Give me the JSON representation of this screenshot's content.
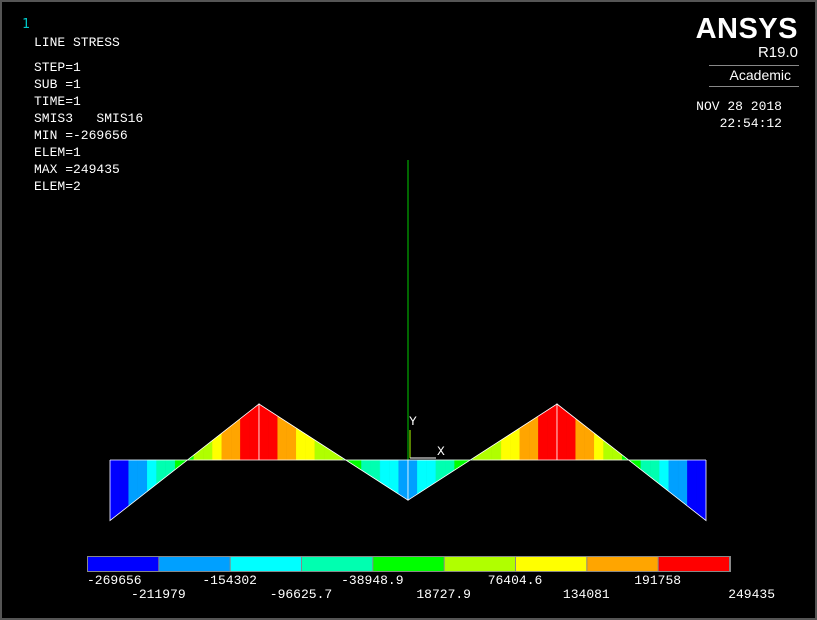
{
  "window_number": "1",
  "plot_title": "LINE STRESS",
  "info_lines": [
    "STEP=1",
    "SUB =1",
    "TIME=1",
    "SMIS3   SMIS16",
    "MIN =-269656",
    "ELEM=1",
    "MAX =249435",
    "ELEM=2"
  ],
  "brand": {
    "name": "ANSYS",
    "release": "R19.0",
    "edition": "Academic"
  },
  "timestamp": {
    "date": "NOV 28 2018",
    "time": "22:54:12"
  },
  "axes_triad": {
    "y_label": "Y",
    "x_label": "X"
  },
  "colors": {
    "background": "#000000",
    "axis_line": "#00cc00",
    "band_colors": [
      "#0000ff",
      "#00a0ff",
      "#00ffff",
      "#00ffb0",
      "#00ff00",
      "#b0ff00",
      "#ffff00",
      "#ffa500",
      "#ff0000"
    ]
  },
  "chart_data": {
    "type": "line",
    "title": "LINE STRESS",
    "quantity": "SMIS3   SMIS16",
    "min": -269656,
    "min_elem": 1,
    "max": 249435,
    "max_elem": 2,
    "contour_levels": [
      "-269656",
      "-211979",
      "-154302",
      "-96625.7",
      "-38948.9",
      "18727.9",
      "76404.6",
      "134081",
      "191758",
      "249435"
    ],
    "elements": [
      {
        "elem": 1,
        "stress_i": -269656,
        "stress_j": 249435
      },
      {
        "elem": 2,
        "stress_i": 249435,
        "stress_j": -179000
      },
      {
        "elem": 3,
        "stress_i": -179000,
        "stress_j": 249435
      },
      {
        "elem": 4,
        "stress_i": 249435,
        "stress_j": -269656
      }
    ]
  }
}
